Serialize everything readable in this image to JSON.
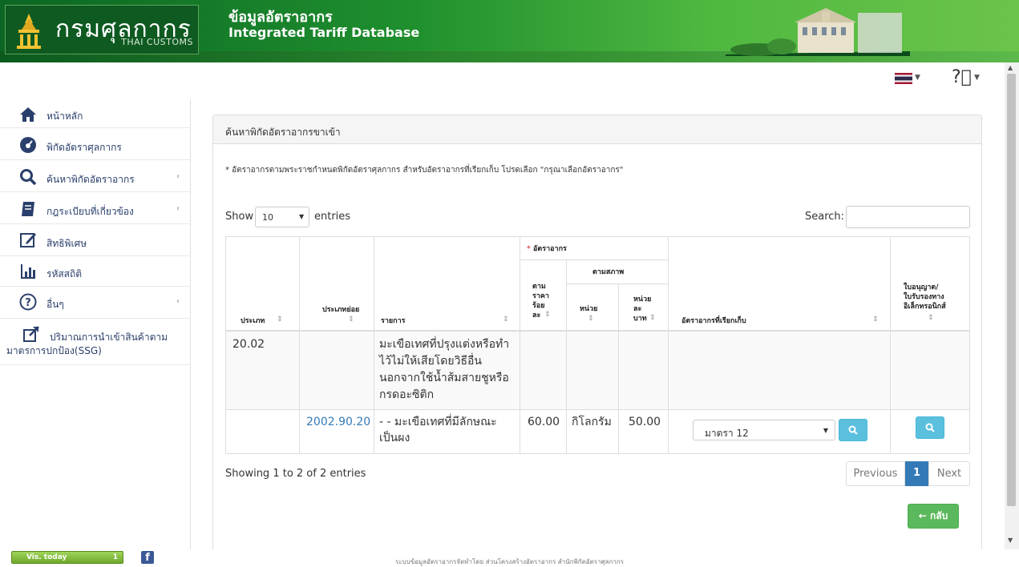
{
  "header": {
    "logo_text": "กรมศุลกากร",
    "logo_sub": "THAI CUSTOMS",
    "title": "ข้อมูลอัตราอากร",
    "subtitle": "Integrated Tariff Database"
  },
  "topbar": {
    "language_flag": "thai-flag-icon",
    "help_icon": "help-icon"
  },
  "sidebar": {
    "items": [
      {
        "label": "หน้าหลัก",
        "icon": "home-icon"
      },
      {
        "label": "พิกัดอัตราศุลกากร",
        "icon": "dashboard-icon"
      },
      {
        "label": "ค้นหาพิกัดอัตราอากร",
        "icon": "search-icon"
      },
      {
        "label": "กฎระเบียบที่เกี่ยวข้อง",
        "icon": "book-icon"
      },
      {
        "label": "สิทธิพิเศษ",
        "icon": "edit-icon"
      },
      {
        "label": "รหัสสถิติ",
        "icon": "bar-chart-icon"
      },
      {
        "label": "อื่นๆ",
        "icon": "question-icon"
      },
      {
        "label_line1": "ปริมาณการนำเข้าสินค้าตาม",
        "label_line2": "มาตรการปกป้อง(SSG)",
        "icon": "external-link-icon"
      }
    ]
  },
  "panel": {
    "title": "ค้นหาพิกัดอัตราอากรขาเข้า",
    "note": "* อัตราอากรตามพระราชกำหนดพิกัดอัตราศุลกากร สำหรับอัตราอากรที่เรียกเก็บ โปรดเลือก \"กรุณาเลือกอัตราอากร\""
  },
  "table_controls": {
    "show": "Show",
    "entries_value": "10",
    "entries": "entries",
    "search": "Search:"
  },
  "table": {
    "headers": {
      "type": "ประเภท",
      "subtype": "ประเภทย่อย",
      "description": "รายการ",
      "duty_group": "อัตราอากร",
      "duty_star": "*",
      "ad_valorem_1": "ตาม",
      "ad_valorem_2": "ราคา",
      "ad_valorem_3": "ร้อย",
      "ad_valorem_4": "ละ",
      "specific_group": "ตามสภาพ",
      "unit": "หน่วย",
      "per_unit_1": "หน่วย",
      "per_unit_2": "ละ",
      "per_unit_3": "บาท",
      "collected": "อัตราอากรที่เรียกเก็บ",
      "license_1": "ใบอนุญาต/",
      "license_2": "ใบรับรองทาง",
      "license_3": "อิเล็กทรอนิกส์"
    },
    "rows": [
      {
        "type": "20.02",
        "subtype": "",
        "description_lines": [
          "มะเขือเทศที่ปรุงแต่งหรือทำ",
          "ไว้ไม่ให้เสียโดยวิธีอื่น",
          "นอกจากใช้น้ำส้มสายชูหรือ",
          "กรดอะซิติก"
        ],
        "ad_valorem": "",
        "unit": "",
        "per_unit": ""
      },
      {
        "type": "",
        "subtype": "2002.90.20",
        "description_lines": [
          "- - มะเขือเทศที่มีลักษณะ",
          "เป็นผง"
        ],
        "ad_valorem": "60.00",
        "unit": "กิโลกรัม",
        "per_unit": "50.00",
        "collected_select": "มาตรา 12"
      }
    ]
  },
  "pagination": {
    "showing": "Showing 1 to 2 of 2 entries",
    "previous": "Previous",
    "current": "1",
    "next": "Next"
  },
  "back_button": "← กลับ",
  "footer": {
    "vis_label": "Vis. today",
    "vis_count": "1",
    "facebook": "f",
    "text": "ระบบข้อมูลอัตราอากรจัดทำโดย ส่วนโครงสร้างอัตราอากร สำนักพิกัดอัตราศุลกากร"
  },
  "colors": {
    "header_green": "#1f8f2e",
    "nav_text": "#2a3f6b",
    "link": "#337ab7",
    "info_button": "#5bc0de",
    "success_button": "#5cb85c"
  }
}
